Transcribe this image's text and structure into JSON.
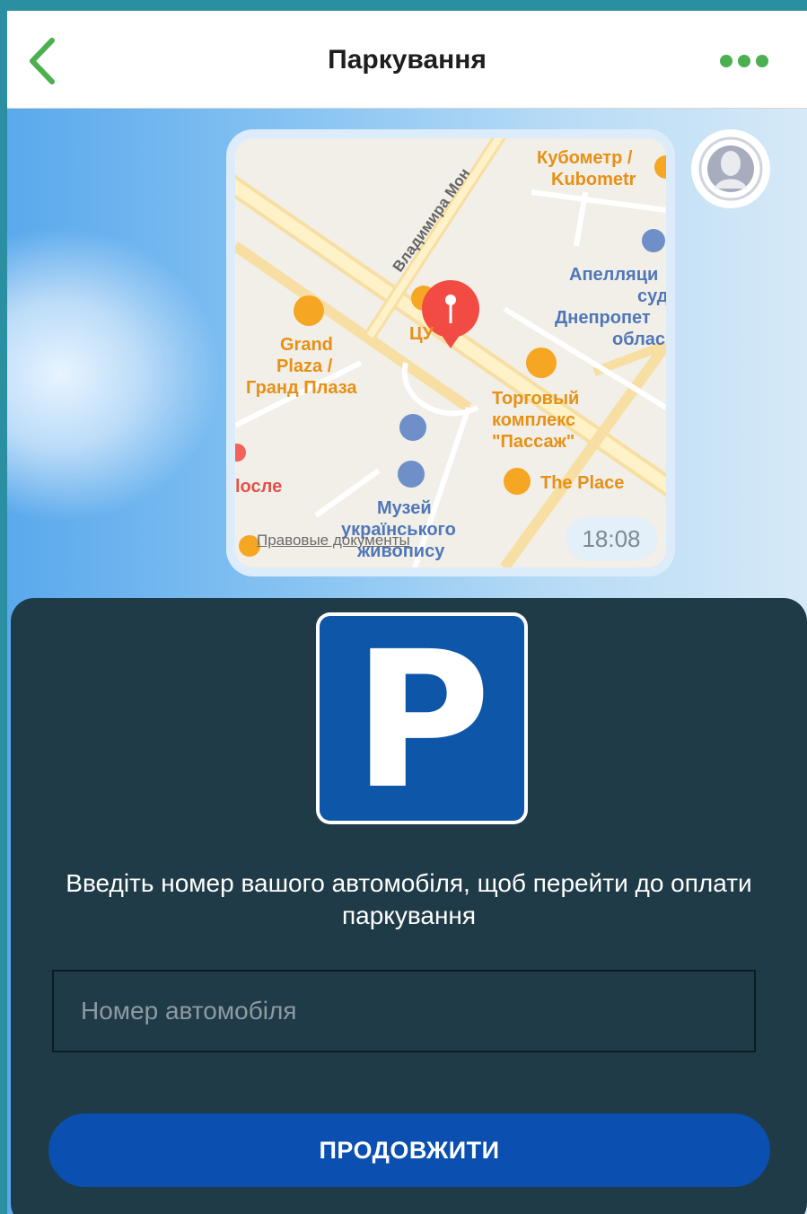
{
  "header": {
    "title": "Паркування",
    "accent": "#4caf50"
  },
  "message": {
    "time": "18:08",
    "map": {
      "legal_link": "Правовые документы",
      "street": "Владимира Мон",
      "places": {
        "kubometr": "Кубометр / Kubometr",
        "appeal_court": "Апелляци суд Днепропет облас",
        "grand_plaza": "Grand Plaza / Гранд Плаза",
        "center": "ЦУ",
        "passage": "Торговый комплекс \"Пассаж\"",
        "the_place": "The Place",
        "posle": "lосле",
        "museum": "Музей українського живопису"
      }
    }
  },
  "parking": {
    "sign_letter": "P",
    "prompt": "Введіть номер вашого автомобіля, щоб перейти до оплати паркування",
    "plate_placeholder": "Номер автомобіля",
    "continue_label": "ПРОДОВЖИТИ",
    "colors": {
      "sheet": "#1f3b47",
      "button": "#0b4fb0",
      "sign": "#0e56a8"
    }
  }
}
